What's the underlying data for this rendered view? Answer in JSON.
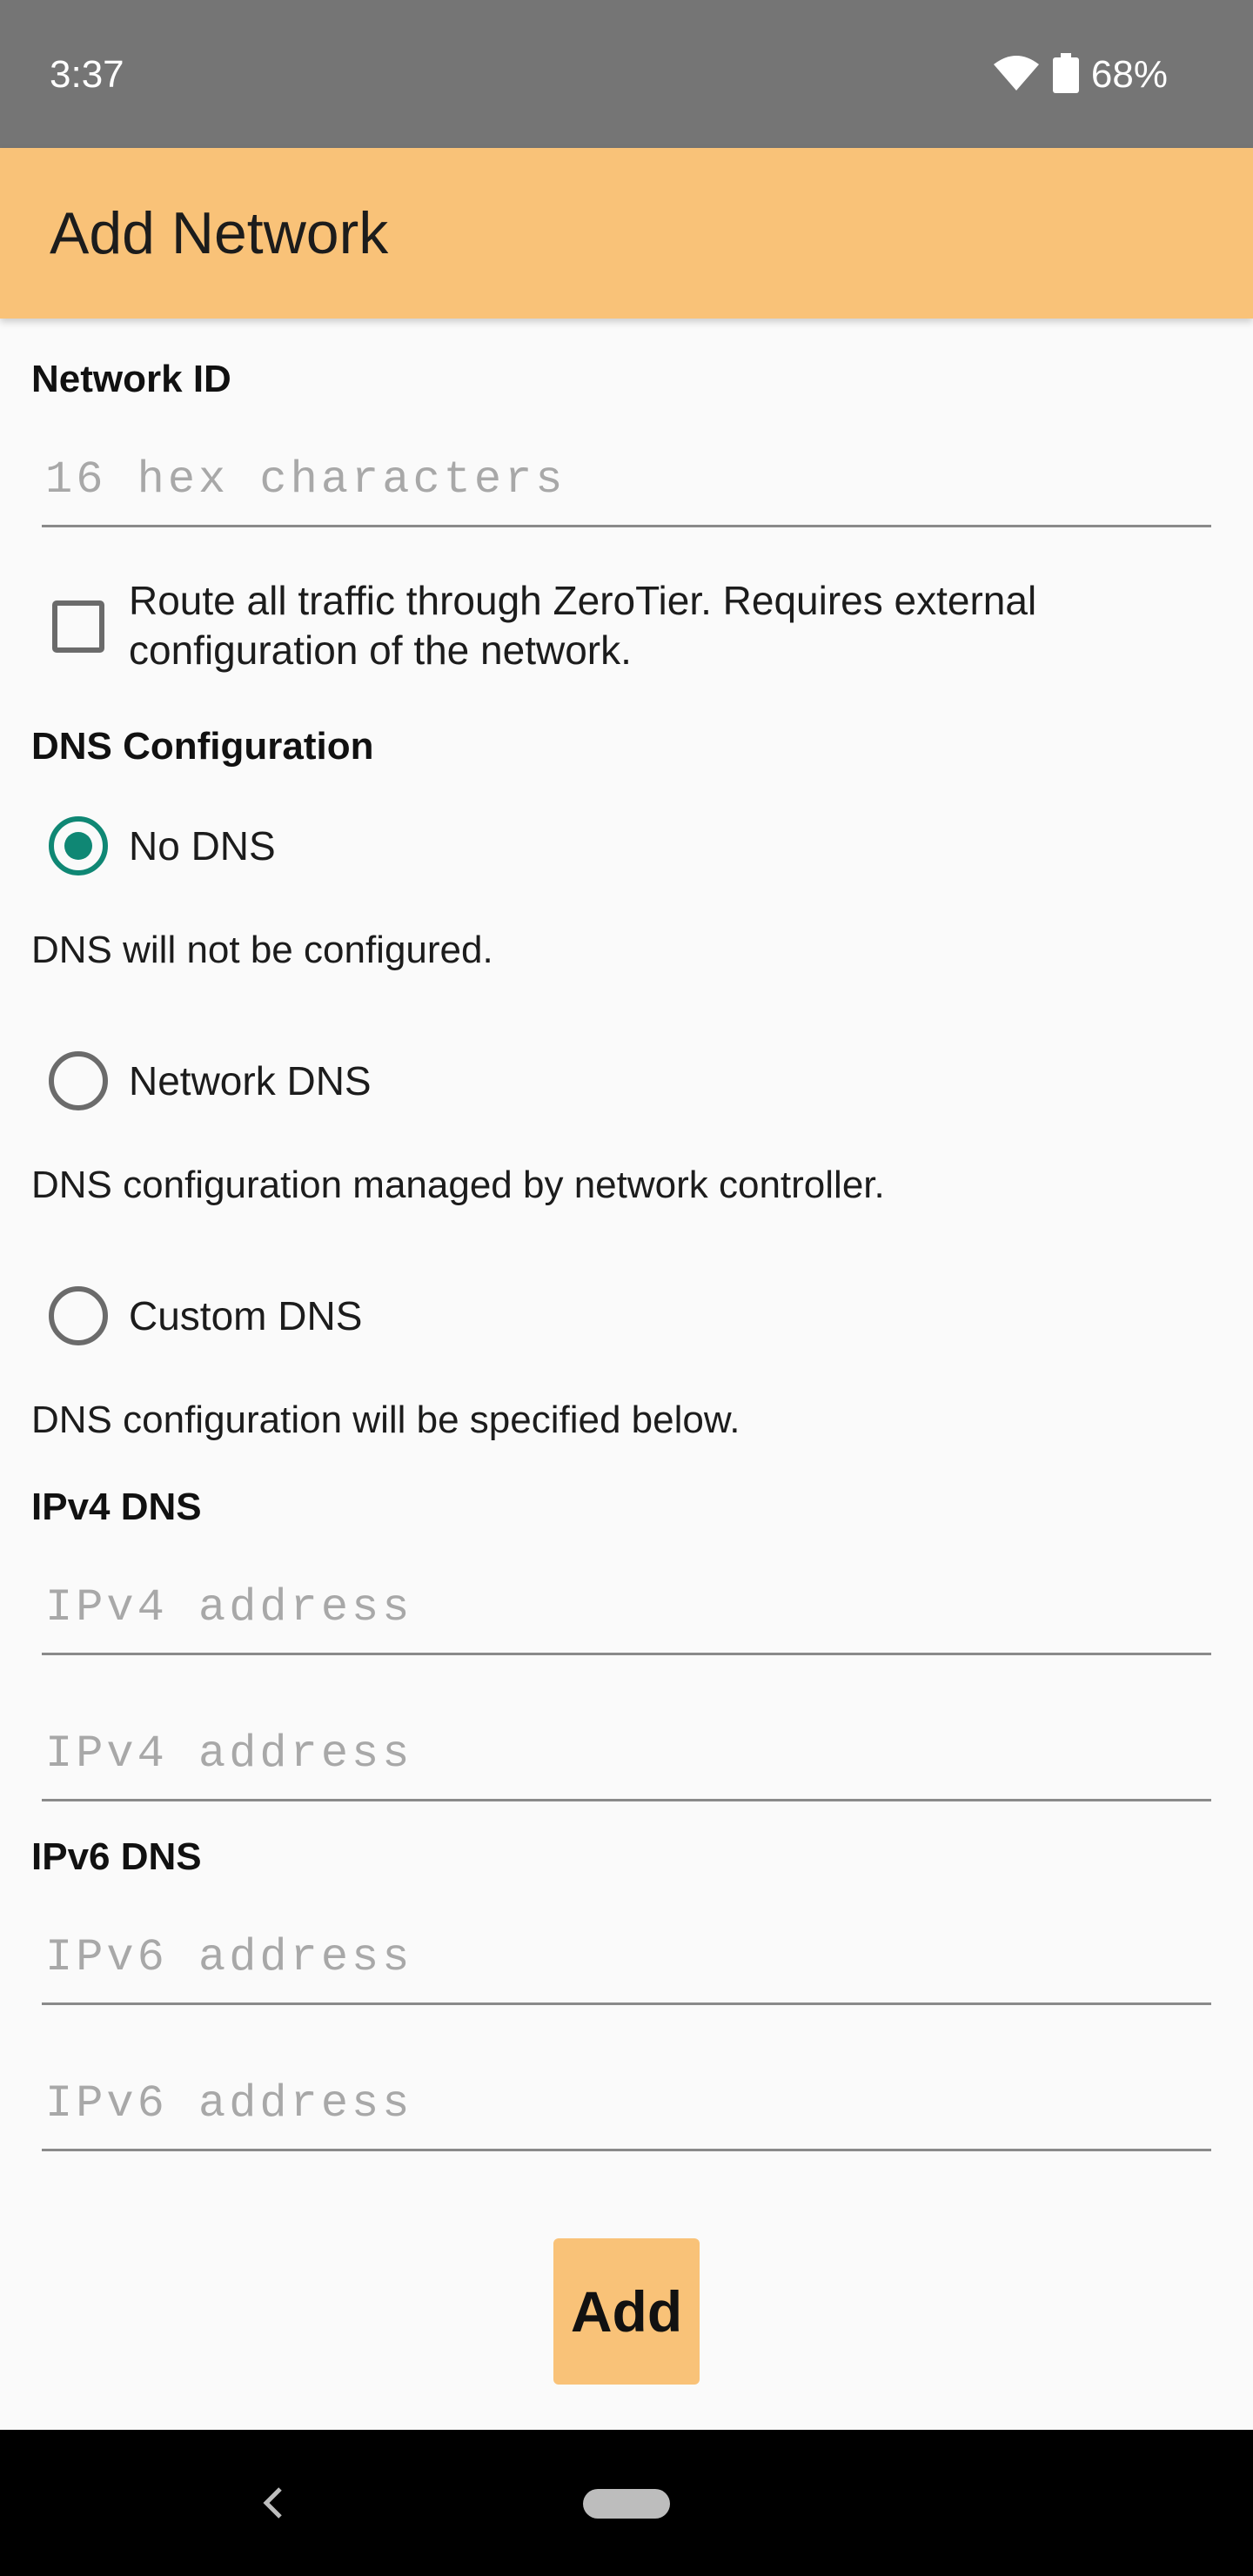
{
  "status_bar": {
    "time": "3:37",
    "battery_percent": "68%",
    "icons": [
      "wifi-icon",
      "battery-icon"
    ]
  },
  "app_bar": {
    "title": "Add Network",
    "color": "#f9c278"
  },
  "network_id": {
    "label": "Network ID",
    "value": "",
    "placeholder": "16 hex characters"
  },
  "route_all_traffic": {
    "label": "Route all traffic through ZeroTier. Requires external configuration of the network.",
    "checked": false
  },
  "dns": {
    "label": "DNS Configuration",
    "selected": "No DNS",
    "accent_color": "#0f8774",
    "options": [
      {
        "label": "No DNS",
        "description": "DNS will not be configured.",
        "checked": true
      },
      {
        "label": "Network DNS",
        "description": "DNS configuration managed by network controller.",
        "checked": false
      },
      {
        "label": "Custom DNS",
        "description": "DNS configuration will be specified below.",
        "checked": false
      }
    ]
  },
  "ipv4": {
    "label": "IPv4 DNS",
    "fields": [
      {
        "value": "",
        "placeholder": "IPv4 address"
      },
      {
        "value": "",
        "placeholder": "IPv4 address"
      }
    ]
  },
  "ipv6": {
    "label": "IPv6 DNS",
    "fields": [
      {
        "value": "",
        "placeholder": "IPv6 address"
      },
      {
        "value": "",
        "placeholder": "IPv6 address"
      }
    ]
  },
  "actions": {
    "add_label": "Add"
  },
  "nav_bar": {
    "icons": [
      "back-icon",
      "home-pill-icon"
    ]
  }
}
